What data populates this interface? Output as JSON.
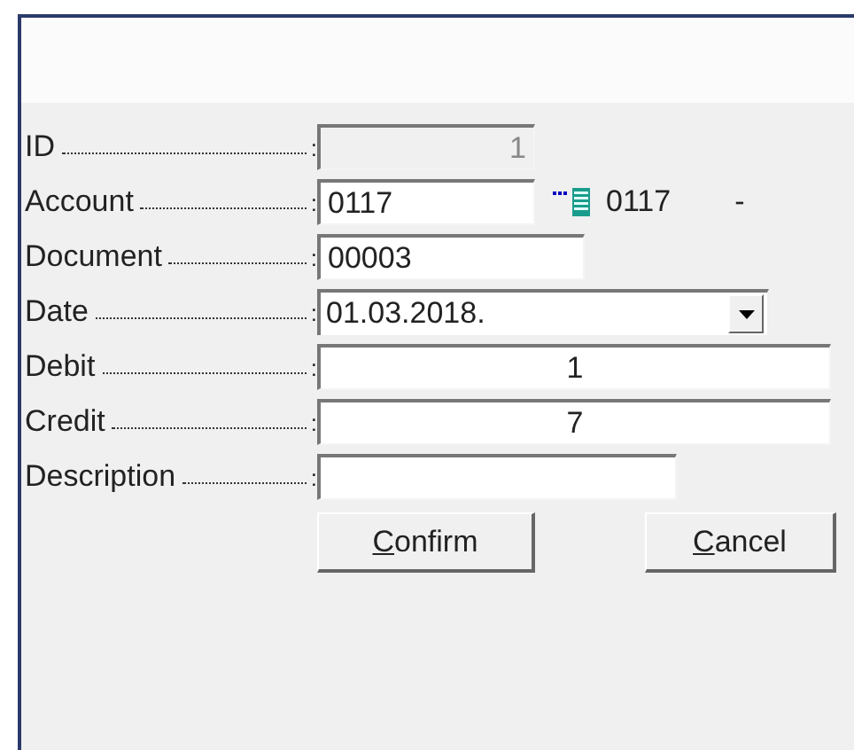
{
  "fields": [
    {
      "label": "ID",
      "colon": ":",
      "kind": "id",
      "value": "1",
      "disabled": true
    },
    {
      "label": "Account",
      "colon": ":",
      "kind": "lookup",
      "value": "0117",
      "disabled": false,
      "lookup_code": "0117",
      "lookup_dash": "-"
    },
    {
      "label": "Document",
      "colon": ":",
      "kind": "text",
      "value": "00003",
      "disabled": false
    },
    {
      "label": "Date",
      "colon": ":",
      "kind": "date",
      "value": "01.03.2018.",
      "disabled": false
    },
    {
      "label": "Debit",
      "colon": ":",
      "kind": "amount",
      "value": "1",
      "disabled": false
    },
    {
      "label": "Credit",
      "colon": ":",
      "kind": "amount",
      "value": "7",
      "disabled": false
    },
    {
      "label": "Description",
      "colon": ":",
      "kind": "text",
      "disabled": false
    }
  ],
  "buttons": [
    {
      "label": "Confirm",
      "mnemonic_underlined": true
    },
    {
      "label": "Cancel",
      "mnemonic_underlined": true
    }
  ]
}
